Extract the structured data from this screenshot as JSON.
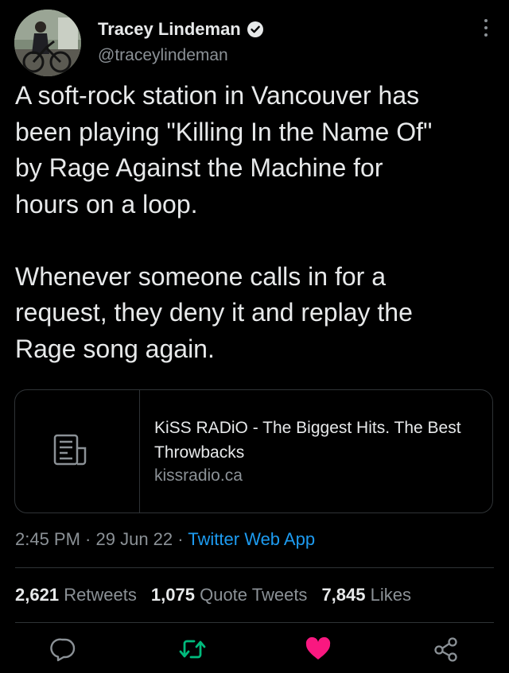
{
  "author": {
    "name": "Tracey Lindeman",
    "handle": "@traceylindeman"
  },
  "tweet": {
    "text": "A soft-rock station in Vancouver has\nbeen playing \"Killing In the Name Of\"\nby Rage Against the Machine for\nhours on a loop.\n\nWhenever someone calls in for a\nrequest, they deny it and replay the\nRage song again."
  },
  "card": {
    "title": "KiSS RADiO - The Biggest Hits. The Best Throwbacks",
    "domain": "kissradio.ca"
  },
  "meta": {
    "time": "2:45 PM",
    "separator1": " · ",
    "date": "29 Jun 22",
    "separator2": " · ",
    "source": "Twitter Web App"
  },
  "stats": {
    "retweets_count": "2,621",
    "retweets_label": "Retweets",
    "quotes_count": "1,075",
    "quotes_label": "Quote Tweets",
    "likes_count": "7,845",
    "likes_label": "Likes"
  },
  "colors": {
    "background": "#000000",
    "text": "#e7e9ea",
    "secondary": "#8b9196",
    "link": "#1d9bf0",
    "retweet": "#00ba7c",
    "like": "#f91880"
  }
}
